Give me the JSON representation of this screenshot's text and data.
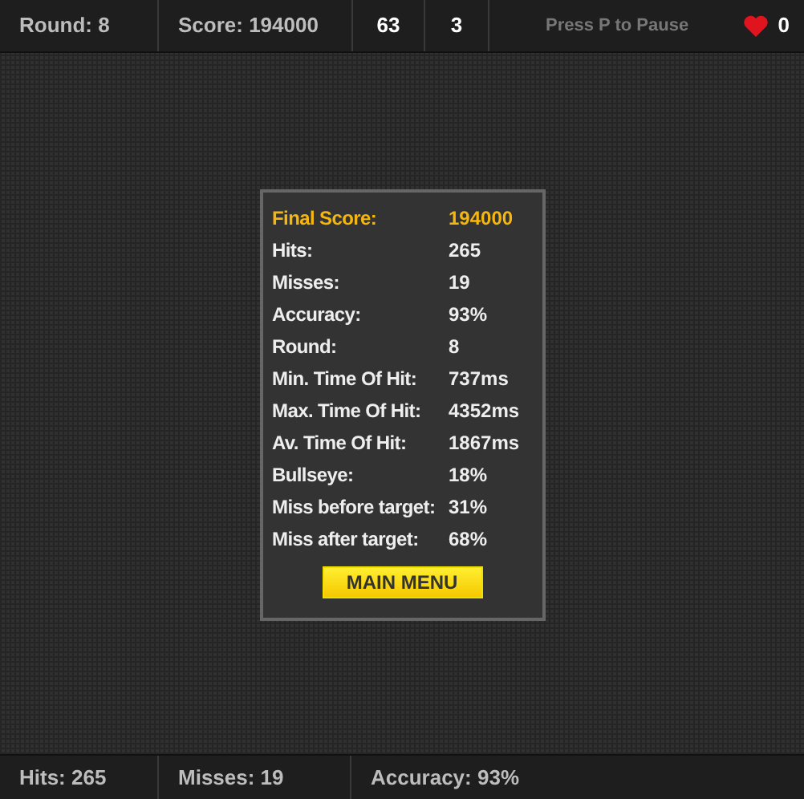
{
  "top_bar": {
    "round": "Round: 8",
    "score": "Score: 194000",
    "counter_1": "63",
    "counter_2": "3",
    "pause_hint": "Press P to Pause",
    "lives": "0"
  },
  "results": {
    "rows": [
      {
        "label": "Final Score:",
        "value": "194000",
        "kind": "highlight"
      },
      {
        "label": "Hits:",
        "value": "265",
        "kind": "plain"
      },
      {
        "label": "Misses:",
        "value": "19",
        "kind": "plain"
      },
      {
        "label": "Accuracy:",
        "value": "93%",
        "kind": "plain"
      },
      {
        "label": "Round:",
        "value": "8",
        "kind": "plain"
      },
      {
        "label": "Min. Time Of Hit:",
        "value": "737ms",
        "kind": "plain"
      },
      {
        "label": "Max. Time Of Hit:",
        "value": "4352ms",
        "kind": "plain"
      },
      {
        "label": "Av. Time Of Hit:",
        "value": "1867ms",
        "kind": "plain"
      },
      {
        "label": "Bullseye:",
        "value": "18%",
        "kind": "plain"
      },
      {
        "label": "Miss before target:",
        "value": "31%",
        "kind": "plain"
      },
      {
        "label": "Miss after target:",
        "value": "68%",
        "kind": "plain"
      }
    ],
    "button": "MAIN MENU"
  },
  "bottom_bar": {
    "hits": "Hits: 265",
    "misses": "Misses: 19",
    "accuracy": "Accuracy: 93%"
  }
}
